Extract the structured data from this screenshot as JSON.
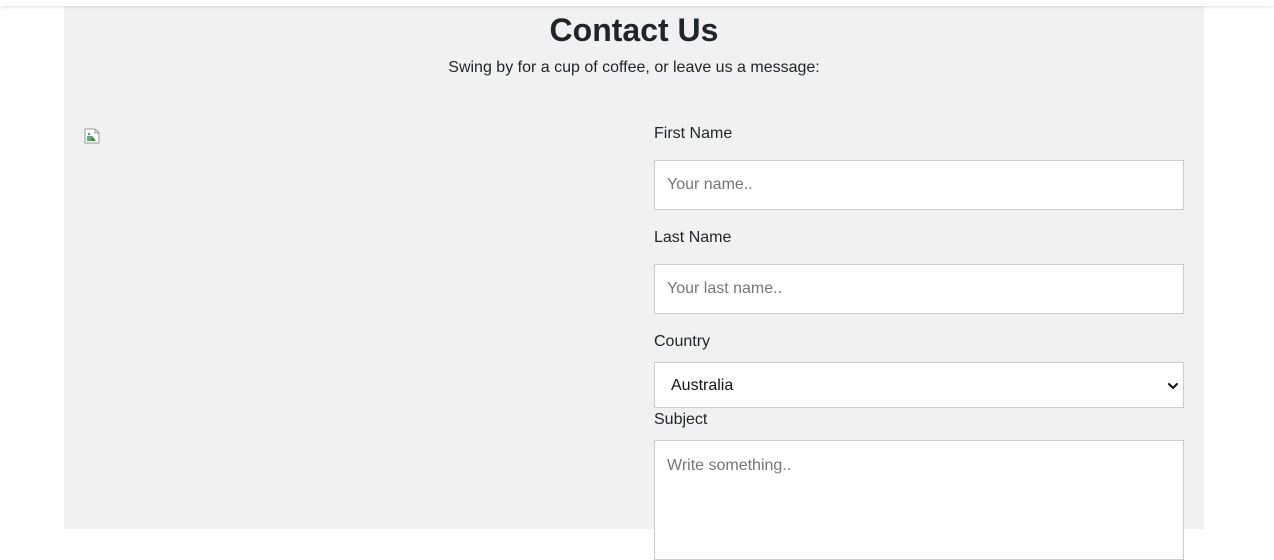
{
  "header": {
    "title": "Contact Us",
    "subtitle": "Swing by for a cup of coffee, or leave us a message:"
  },
  "form": {
    "first_name": {
      "label": "First Name",
      "placeholder": "Your name.."
    },
    "last_name": {
      "label": "Last Name",
      "placeholder": "Your last name.."
    },
    "country": {
      "label": "Country",
      "selected": "Australia"
    },
    "subject": {
      "label": "Subject",
      "placeholder": "Write something.."
    }
  },
  "icons": {
    "broken_image": "broken-image-icon",
    "select_arrow": "chevron-down-icon"
  },
  "colors": {
    "panel_background": "#f1f1f1",
    "page_background": "#ffffff",
    "input_border": "#cccccc"
  }
}
